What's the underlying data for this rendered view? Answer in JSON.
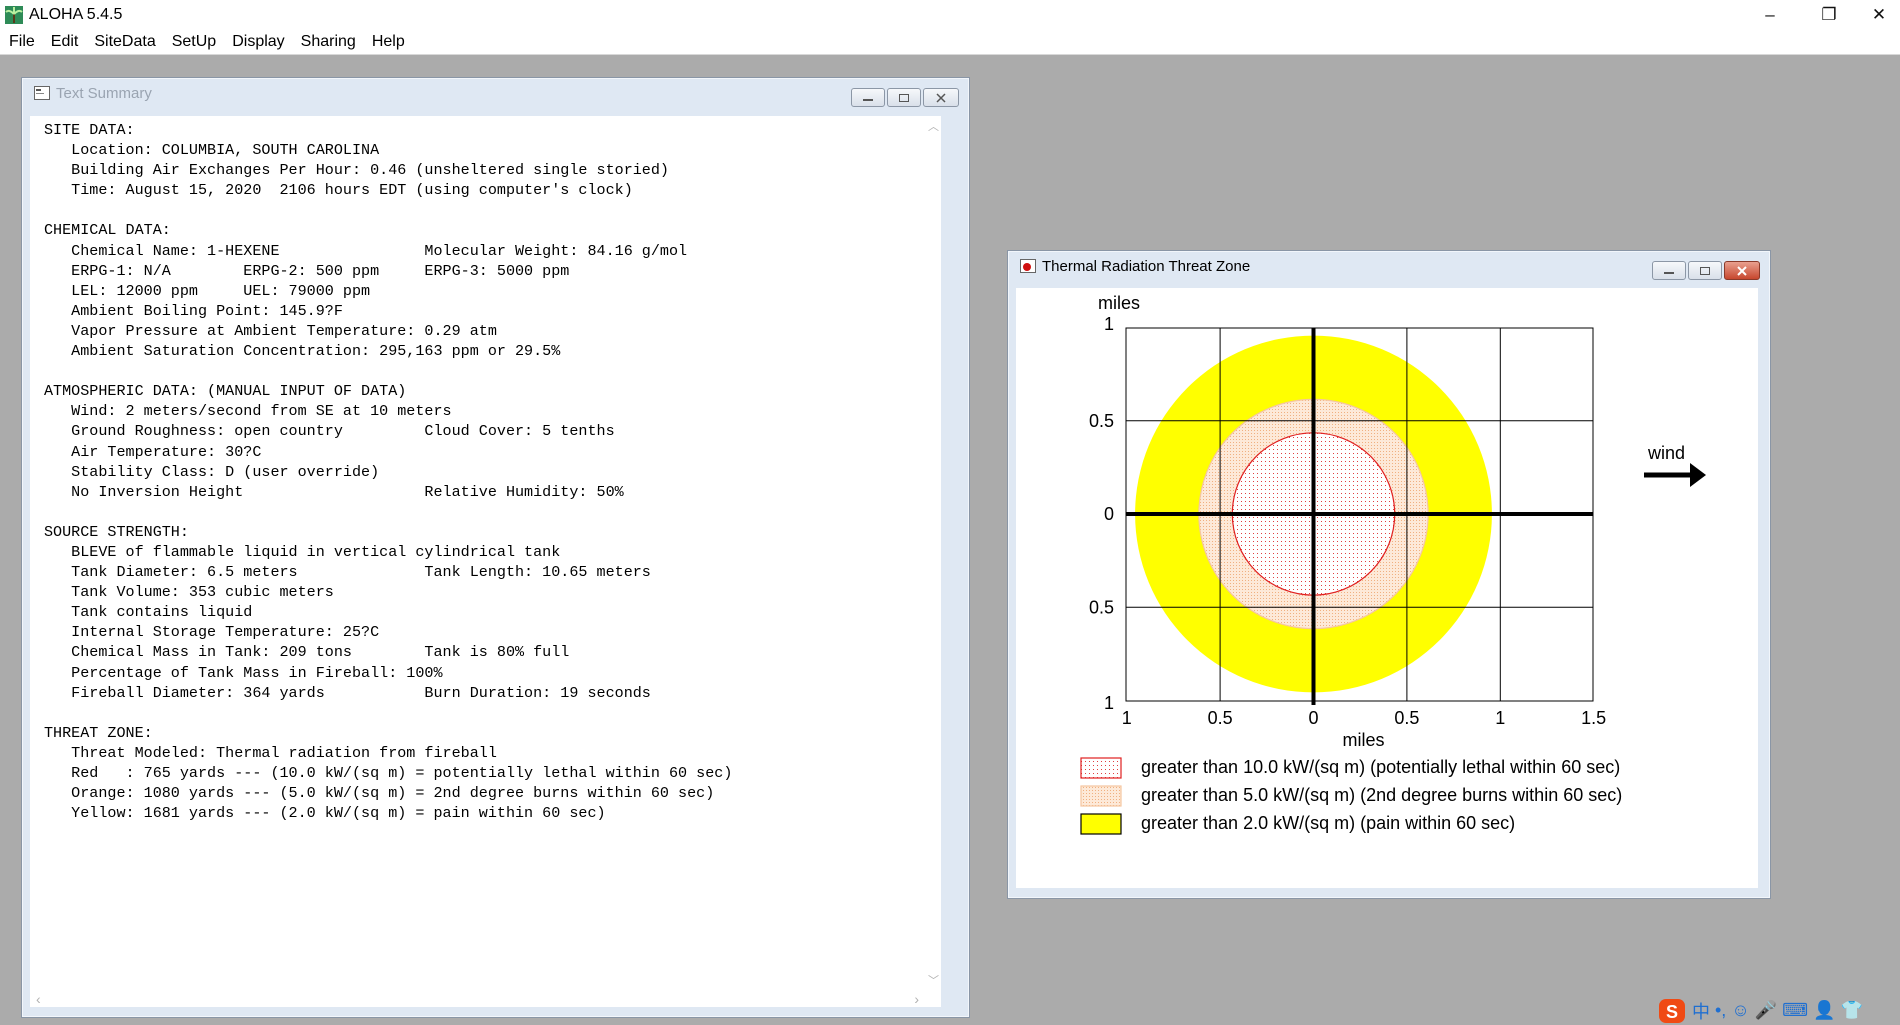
{
  "app": {
    "title": "ALOHA 5.4.5",
    "window_controls": [
      "–",
      "❐",
      "✕"
    ]
  },
  "menubar": {
    "items": [
      "File",
      "Edit",
      "SiteData",
      "SetUp",
      "Display",
      "Sharing",
      "Help"
    ]
  },
  "text_summary": {
    "title": "Text Summary",
    "lines": [
      "SITE DATA:",
      "   Location: COLUMBIA, SOUTH CAROLINA",
      "   Building Air Exchanges Per Hour: 0.46 (unsheltered single storied)",
      "   Time: August 15, 2020  2106 hours EDT (using computer's clock)",
      "",
      "CHEMICAL DATA:",
      "   Chemical Name: 1-HEXENE                Molecular Weight: 84.16 g/mol",
      "   ERPG-1: N/A        ERPG-2: 500 ppm     ERPG-3: 5000 ppm",
      "   LEL: 12000 ppm     UEL: 79000 ppm",
      "   Ambient Boiling Point: 145.9?F",
      "   Vapor Pressure at Ambient Temperature: 0.29 atm",
      "   Ambient Saturation Concentration: 295,163 ppm or 29.5%",
      "",
      "ATMOSPHERIC DATA: (MANUAL INPUT OF DATA)",
      "   Wind: 2 meters/second from SE at 10 meters",
      "   Ground Roughness: open country         Cloud Cover: 5 tenths",
      "   Air Temperature: 30?C",
      "   Stability Class: D (user override)",
      "   No Inversion Height                    Relative Humidity: 50%",
      "",
      "SOURCE STRENGTH:",
      "   BLEVE of flammable liquid in vertical cylindrical tank",
      "   Tank Diameter: 6.5 meters              Tank Length: 10.65 meters",
      "   Tank Volume: 353 cubic meters",
      "   Tank contains liquid",
      "   Internal Storage Temperature: 25?C",
      "   Chemical Mass in Tank: 209 tons        Tank is 80% full",
      "   Percentage of Tank Mass in Fireball: 100%",
      "   Fireball Diameter: 364 yards           Burn Duration: 19 seconds",
      "",
      "THREAT ZONE:",
      "   Threat Modeled: Thermal radiation from fireball",
      "   Red   : 765 yards --- (10.0 kW/(sq m) = potentially lethal within 60 sec)",
      "   Orange: 1080 yards --- (5.0 kW/(sq m) = 2nd degree burns within 60 sec)",
      "   Yellow: 1681 yards --- (2.0 kW/(sq m) = pain within 60 sec)"
    ]
  },
  "threat_zone": {
    "title": "Thermal Radiation Threat Zone",
    "wind_label": "wind",
    "colors": {
      "red": "#e02020",
      "orange_fill": "#f8ddc8",
      "yellow": "#ffff00"
    },
    "chart_data": {
      "type": "diagram",
      "x_unit_label": "miles",
      "y_unit_label": "miles",
      "x_ticks": [
        "1",
        "0.5",
        "0",
        "0.5",
        "1",
        "1.5"
      ],
      "y_ticks": [
        "1",
        "0.5",
        "0",
        "0.5",
        "1"
      ],
      "xlim": [
        -1,
        1.5
      ],
      "ylim": [
        -1,
        1
      ],
      "zones": [
        {
          "name": "yellow",
          "radius_yards": 1681,
          "label": "greater than 2.0 kW/(sq m) (pain within 60 sec)",
          "color": "#ffff00"
        },
        {
          "name": "orange",
          "radius_yards": 1080,
          "label": "greater than 5.0 kW/(sq m) (2nd degree burns within 60 sec)",
          "color": "#f8ddc8"
        },
        {
          "name": "red",
          "radius_yards": 765,
          "label": "greater than 10.0 kW/(sq m) (potentially lethal within 60 sec)",
          "color": "#e02020"
        }
      ],
      "legend": [
        "greater than 10.0 kW/(sq m) (potentially lethal within 60 sec)",
        "greater than 5.0 kW/(sq m) (2nd degree burns within 60 sec)",
        "greater than 2.0 kW/(sq m) (pain within 60 sec)"
      ]
    }
  },
  "tray": {
    "ime_label": "中"
  }
}
